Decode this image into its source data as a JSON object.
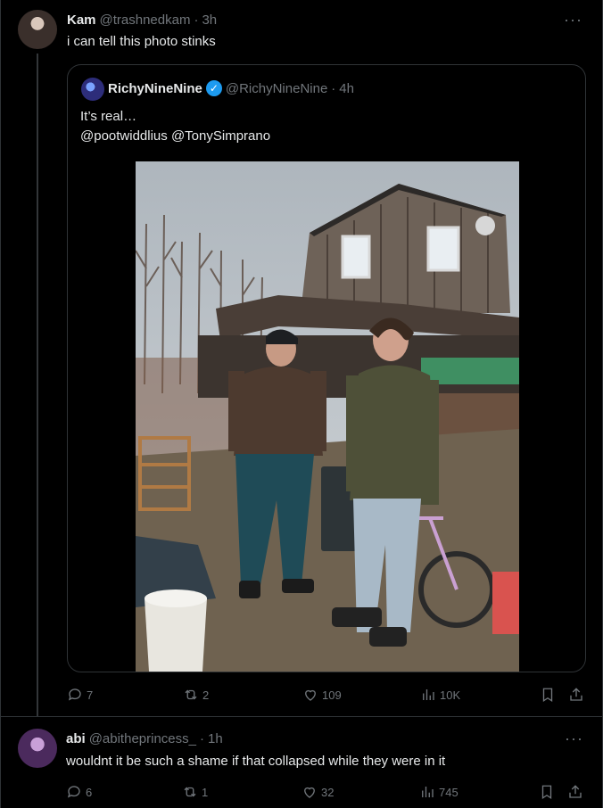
{
  "post": {
    "author_name": "Kam",
    "author_handle": "@trashnedkam",
    "time": "3h",
    "text": "i can tell this photo stinks",
    "quote": {
      "author_name": "RichyNineNine",
      "author_handle": "@RichyNineNine",
      "time": "4h",
      "verified": true,
      "line1": "It’s real…",
      "line2": "@pootwiddlius @TonySimprano"
    },
    "stats": {
      "replies": "7",
      "reposts": "2",
      "likes": "109",
      "views": "10K"
    }
  },
  "reply": {
    "author_name": "abi",
    "author_handle": "@abitheprincess_",
    "time": "1h",
    "text": "wouldnt it be such a shame if that collapsed while they were in it",
    "stats": {
      "replies": "6",
      "reposts": "1",
      "likes": "32",
      "views": "745"
    }
  },
  "ui": {
    "separator": "·",
    "more": "···",
    "verified_mark": "✓"
  },
  "colors": {
    "background": "#000000",
    "text": "#e7e9ea",
    "muted": "#71767b",
    "border": "#2f3336",
    "verified": "#1d9bf0"
  }
}
